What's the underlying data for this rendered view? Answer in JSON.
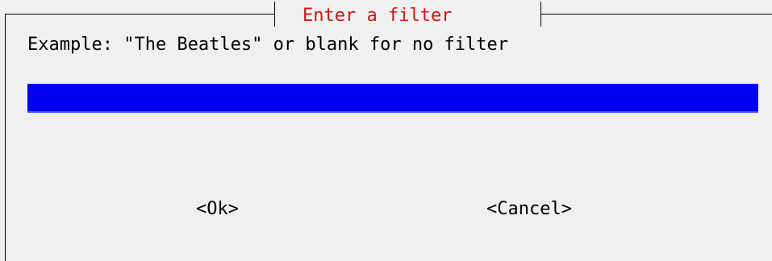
{
  "dialog": {
    "title": "Enter a filter",
    "prompt": "Example: \"The Beatles\" or blank for no filter",
    "input": {
      "value": "",
      "placeholder": ""
    },
    "buttons": {
      "ok_label": "<Ok>",
      "cancel_label": "<Cancel>"
    }
  },
  "colors": {
    "background": "#f0f0f0",
    "title": "#cc1515",
    "input_background": "#0000ee",
    "frame": "#000000"
  }
}
